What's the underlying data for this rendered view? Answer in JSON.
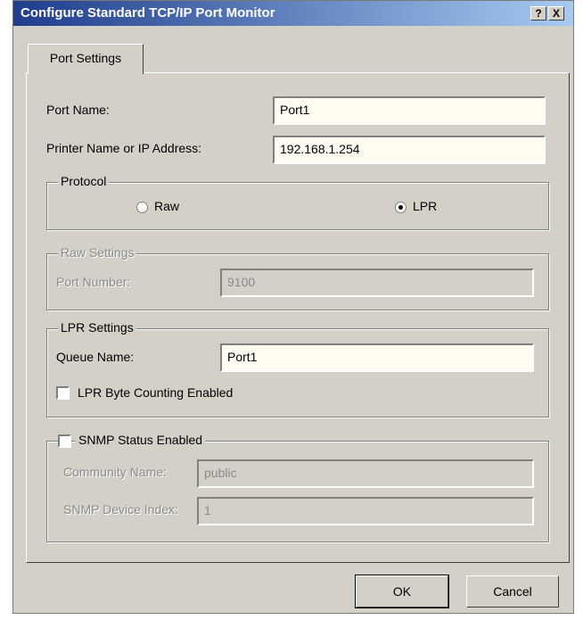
{
  "window": {
    "title": "Configure Standard TCP/IP Port Monitor",
    "help_label": "?",
    "close_label": "X"
  },
  "tabs": [
    {
      "label": "Port Settings",
      "active": true
    }
  ],
  "port_name": {
    "label": "Port Name:",
    "value": "Port1"
  },
  "printer_address": {
    "label": "Printer Name or IP Address:",
    "value": "192.168.1.254"
  },
  "protocol": {
    "legend": "Protocol",
    "options": [
      {
        "label": "Raw",
        "selected": false
      },
      {
        "label": "LPR",
        "selected": true
      }
    ]
  },
  "raw_settings": {
    "legend": "Raw Settings",
    "port_number_label": "Port Number:",
    "port_number_value": "9100",
    "enabled": false
  },
  "lpr_settings": {
    "legend": "LPR Settings",
    "queue_name_label": "Queue Name:",
    "queue_name_value": "Port1",
    "byte_counting_label": "LPR Byte Counting Enabled",
    "byte_counting_checked": false
  },
  "snmp": {
    "legend": "SNMP Status Enabled",
    "checked": false,
    "community_label": "Community Name:",
    "community_value": "public",
    "device_index_label": "SNMP Device Index:",
    "device_index_value": "1"
  },
  "buttons": {
    "ok": "OK",
    "cancel": "Cancel"
  }
}
